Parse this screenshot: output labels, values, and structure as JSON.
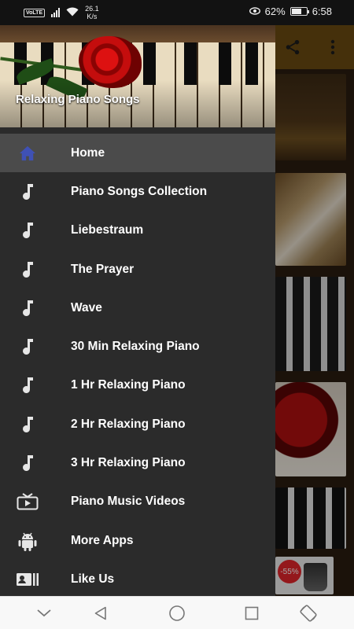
{
  "status_bar": {
    "volte": "VoLTE",
    "net_speed_value": "26.1",
    "net_speed_unit": "K/s",
    "battery": "62%",
    "time": "6:58"
  },
  "drawer": {
    "title": "Relaxing Piano Songs",
    "items": [
      {
        "label": "Home",
        "icon": "home-icon",
        "active": true
      },
      {
        "label": "Piano Songs Collection",
        "icon": "music-note-icon"
      },
      {
        "label": "Liebestraum",
        "icon": "music-note-icon"
      },
      {
        "label": "The Prayer",
        "icon": "music-note-icon"
      },
      {
        "label": "Wave",
        "icon": "music-note-icon"
      },
      {
        "label": "30 Min Relaxing Piano",
        "icon": "music-note-icon"
      },
      {
        "label": "1 Hr Relaxing Piano",
        "icon": "music-note-icon"
      },
      {
        "label": "2 Hr Relaxing Piano",
        "icon": "music-note-icon"
      },
      {
        "label": "3 Hr Relaxing Piano",
        "icon": "music-note-icon"
      },
      {
        "label": "Piano Music Videos",
        "icon": "tv-icon"
      },
      {
        "label": "More Apps",
        "icon": "android-icon"
      },
      {
        "label": "Like Us",
        "icon": "contact-card-icon"
      }
    ]
  },
  "background": {
    "sale_badge": "-55%"
  },
  "colors": {
    "drawer_bg": "#2b2b2b",
    "active_item_bg": "#4b4b4b",
    "home_icon": "#3f51b5",
    "toolbar": "#6a4a12"
  }
}
